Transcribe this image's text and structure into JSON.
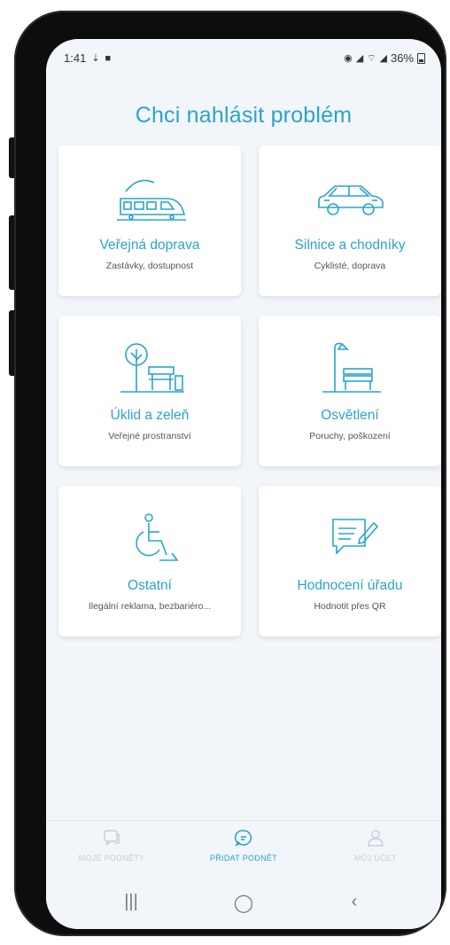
{
  "status_bar": {
    "time": "1:41",
    "battery": "36%"
  },
  "page": {
    "title": "Chci nahlásit problém"
  },
  "cards": [
    {
      "title": "Veřejná doprava",
      "subtitle": "Zastávky, dostupnost",
      "icon": "train-icon"
    },
    {
      "title": "Silnice a chodníky",
      "subtitle": "Cyklisté, doprava",
      "icon": "car-icon"
    },
    {
      "title": "Úklid a zeleň",
      "subtitle": "Veřejné prostranství",
      "icon": "tree-bench-icon"
    },
    {
      "title": "Osvětlení",
      "subtitle": "Poruchy, poškození",
      "icon": "street-lamp-icon"
    },
    {
      "title": "Ostatní",
      "subtitle": "Ilegální reklama, bezbariéro...",
      "icon": "wheelchair-icon"
    },
    {
      "title": "Hodnocení úřadu",
      "subtitle": "Hodnotit přes QR",
      "icon": "feedback-edit-icon"
    }
  ],
  "bottom_nav": {
    "items": [
      {
        "label": "MOJE PODNĚTY",
        "icon": "chat-list-icon",
        "active": false
      },
      {
        "label": "PŘIDAT PODNĚT",
        "icon": "chat-bubble-icon",
        "active": true
      },
      {
        "label": "MŮJ ÚČET",
        "icon": "user-icon",
        "active": false
      }
    ]
  },
  "system_nav": {
    "recents": "|||",
    "home": "◯",
    "back": "‹"
  },
  "colors": {
    "accent": "#2aa5c8",
    "background": "#f2f5f9",
    "card": "#ffffff",
    "muted": "#c7ced6"
  }
}
